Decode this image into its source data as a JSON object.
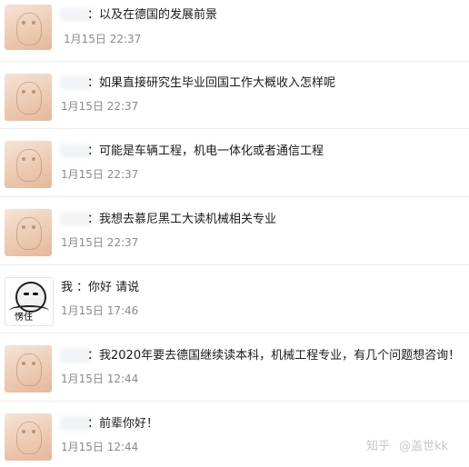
{
  "messages": [
    {
      "text": "：以及在德国的发展前景",
      "time": "1月15日 22:37"
    },
    {
      "text": "：如果直接研究生毕业回国工作大概收入怎样呢",
      "time": "1月15日 22:37"
    },
    {
      "text": "：可能是车辆工程，机电一体化或者通信工程",
      "time": "1月15日 22:37"
    },
    {
      "text": "：我想去慕尼黑工大读机械相关专业",
      "time": "1月15日 22:37"
    },
    {
      "name": "我",
      "text": "：你好 请说",
      "time": "1月15日 17:46",
      "avatar_text": "愣住"
    },
    {
      "text": "：我2020年要去德国继续读本科，机械工程专业，有几个问题想咨询！",
      "time": "1月15日 12:44"
    },
    {
      "text": "：前辈你好！",
      "time": "1月15日 12:44"
    }
  ],
  "watermark": {
    "brand": "知乎",
    "at": "@",
    "author": "盖世kk"
  },
  "icons": {
    "avatar_default": "anime-girl-avatar",
    "avatar_self": "panda-meme-avatar"
  }
}
